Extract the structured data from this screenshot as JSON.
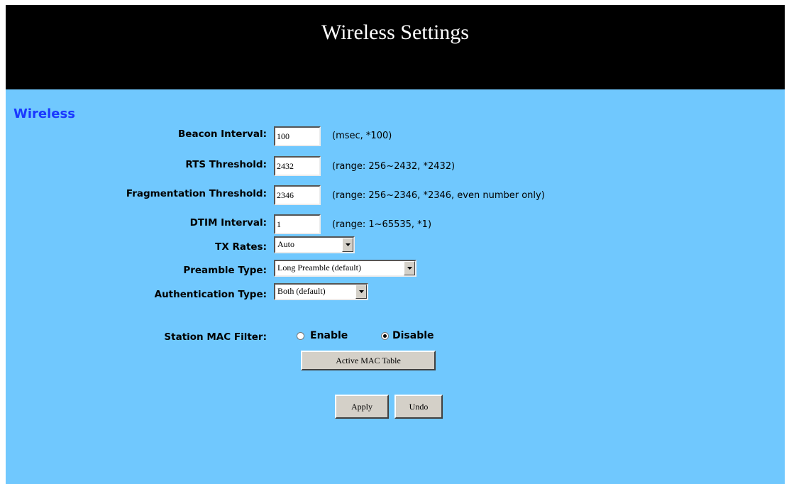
{
  "header": {
    "title": "Wireless Settings"
  },
  "section": {
    "title": "Wireless"
  },
  "fields": {
    "beacon_interval": {
      "label": "Beacon Interval:",
      "value": "100",
      "hint": "(msec, *100)"
    },
    "rts_threshold": {
      "label": "RTS Threshold:",
      "value": "2432",
      "hint": "(range: 256~2432, *2432)"
    },
    "fragmentation_threshold": {
      "label": "Fragmentation Threshold:",
      "value": "2346",
      "hint": "(range: 256~2346, *2346, even number only)"
    },
    "dtim_interval": {
      "label": "DTIM Interval:",
      "value": "1",
      "hint": "(range: 1~65535, *1)"
    },
    "tx_rates": {
      "label": "TX Rates:",
      "selected": "Auto"
    },
    "preamble_type": {
      "label": "Preamble Type:",
      "selected": "Long Preamble (default)"
    },
    "authentication_type": {
      "label": "Authentication Type:",
      "selected": "Both (default)"
    }
  },
  "mac_filter": {
    "label": "Station MAC Filter:",
    "options": [
      "Enable",
      "Disable"
    ],
    "selected": "Disable",
    "table_button": "Active MAC Table"
  },
  "actions": {
    "apply": "Apply",
    "undo": "Undo"
  },
  "colors": {
    "header_bg": "#000000",
    "panel_bg": "#70c8fe",
    "section_title": "#1a38ff"
  },
  "icons": {
    "dropdown": "triangle-down-icon",
    "radio": "radio-button-icon"
  }
}
